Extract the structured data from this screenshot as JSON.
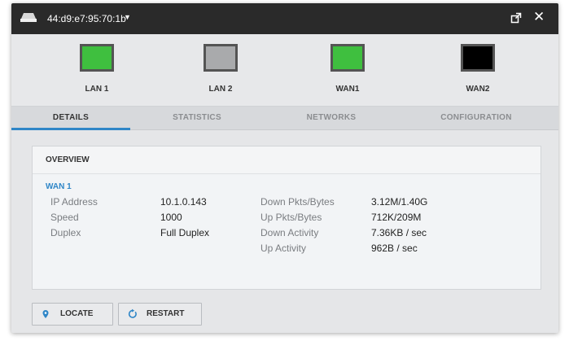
{
  "window": {
    "title": "44:d9:e7:95:70:1b",
    "caret": "▼",
    "close": "✕"
  },
  "ports": [
    {
      "label": "LAN 1",
      "color": "#3fbf3f",
      "border": "#545454"
    },
    {
      "label": "LAN 2",
      "color": "#a9aaac",
      "border": "#545454"
    },
    {
      "label": "WAN1",
      "color": "#3fbf3f",
      "border": "#545454"
    },
    {
      "label": "WAN2",
      "color": "#000000",
      "border": "#545454"
    }
  ],
  "tabs": [
    {
      "label": "DETAILS",
      "active": true
    },
    {
      "label": "STATISTICS",
      "active": false
    },
    {
      "label": "NETWORKS",
      "active": false
    },
    {
      "label": "CONFIGURATION",
      "active": false
    }
  ],
  "overview": {
    "header": "OVERVIEW",
    "section": "WAN 1",
    "left": [
      {
        "label": "IP Address",
        "value": "10.1.0.143"
      },
      {
        "label": "Speed",
        "value": "1000"
      },
      {
        "label": "Duplex",
        "value": "Full Duplex"
      }
    ],
    "right": [
      {
        "label": "Down Pkts/Bytes",
        "value": "3.12M/1.40G"
      },
      {
        "label": "Up Pkts/Bytes",
        "value": "712K/209M"
      },
      {
        "label": "Down Activity",
        "value": "7.36KB / sec"
      },
      {
        "label": "Up Activity",
        "value": "962B / sec"
      }
    ]
  },
  "actions": {
    "locate": "LOCATE",
    "restart": "RESTART"
  },
  "colors": {
    "accent": "#2f86c7",
    "titlebar": "#2a2a2a"
  }
}
